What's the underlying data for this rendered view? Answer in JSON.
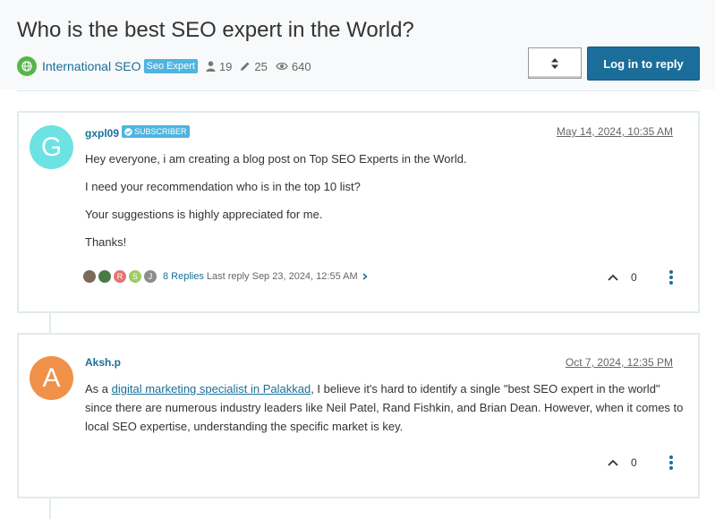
{
  "topic": {
    "title": "Who is the best SEO expert in the World?",
    "category": "International SEO",
    "tag": "Seo Expert",
    "posters": "19",
    "posts": "25",
    "views": "640"
  },
  "actions": {
    "reply_label": "Log in to reply"
  },
  "posts": [
    {
      "avatar_letter": "G",
      "avatar_color": "#6de2e2",
      "username": "gxpl09",
      "badge": "SUBSCRIBER",
      "timestamp": "May 14, 2024, 10:35 AM",
      "paragraphs": [
        "Hey everyone, i am creating a blog post on Top SEO Experts in the World.",
        "I need your recommendation who is in the top 10 list?",
        "Your suggestions is highly appreciated for me.",
        "Thanks!"
      ],
      "replies": {
        "avatars": [
          {
            "letter": "",
            "color": "#7a6a5a"
          },
          {
            "letter": "",
            "color": "#4a7a4a"
          },
          {
            "letter": "R",
            "color": "#e57373"
          },
          {
            "letter": "S",
            "color": "#9ccc65"
          },
          {
            "letter": "J",
            "color": "#8d8d8d"
          }
        ],
        "count_label": "8 Replies",
        "last_reply": "Last reply Sep 23, 2024, 12:55 AM"
      },
      "votes": "0"
    },
    {
      "avatar_letter": "A",
      "avatar_color": "#f0914a",
      "username": "Aksh.p",
      "timestamp": "Oct 7, 2024, 12:35 PM",
      "text_before": "As a ",
      "link_text": "digital marketing specialist in Palakkad",
      "text_after": ", I believe it's hard to identify a single \"best SEO expert in the world\" since there are numerous industry leaders like Neil Patel, Rand Fishkin, and Brian Dean. However, when it comes to local SEO expertise, understanding the specific market is key.",
      "votes": "0"
    }
  ]
}
